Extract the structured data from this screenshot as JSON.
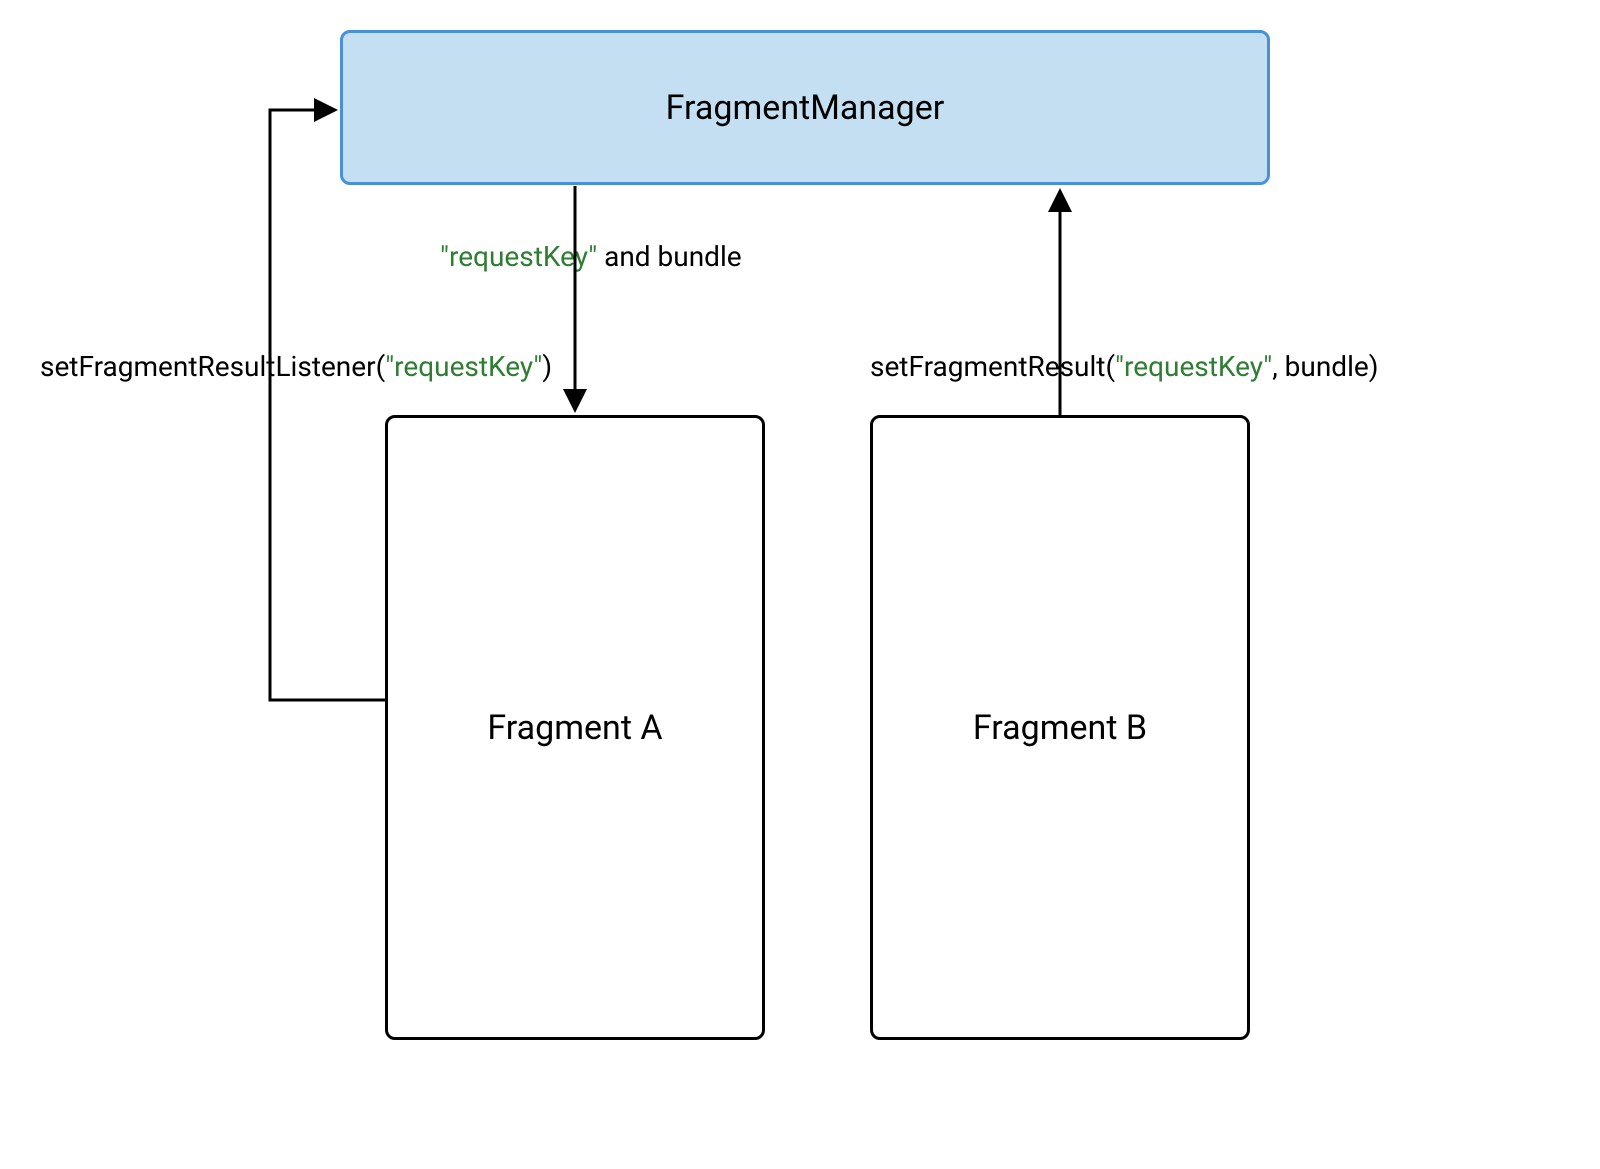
{
  "boxes": {
    "manager": {
      "label": "FragmentManager"
    },
    "fragmentA": {
      "label": "Fragment A"
    },
    "fragmentB": {
      "label": "Fragment B"
    }
  },
  "labels": {
    "listener": {
      "prefix": "setFragmentResultListener(",
      "key": "\"requestKey\"",
      "suffix": ")"
    },
    "deliver": {
      "key": "\"requestKey\"",
      "suffix": " and bundle"
    },
    "result": {
      "prefix": "setFragmentResult(",
      "key": "\"requestKey\"",
      "suffix": ", bundle)"
    }
  }
}
